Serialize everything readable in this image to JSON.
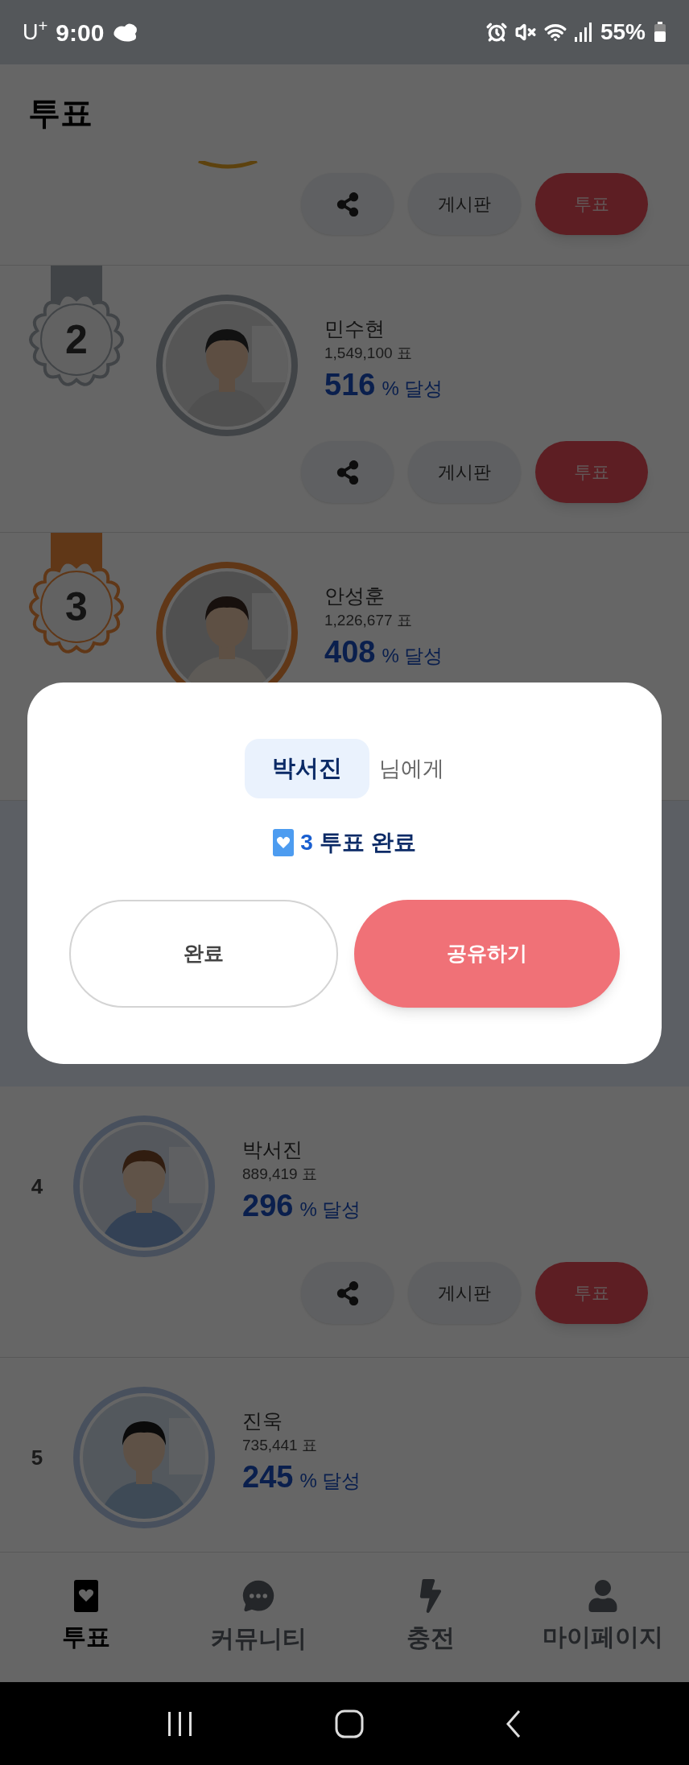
{
  "status_bar": {
    "carrier": "U$^{+}$",
    "time": "9:00",
    "battery": "55%"
  },
  "header": {
    "title": "투표"
  },
  "top_row": {
    "actions": {
      "board": "게시판",
      "vote": "투표"
    }
  },
  "ranking": [
    {
      "kind": "medal",
      "rank": "2",
      "name": "민수현",
      "votes": "1,549,100 표",
      "percent": "516",
      "percent_unit": "% 달성",
      "actions": {
        "board": "게시판",
        "vote": "투표"
      }
    },
    {
      "kind": "medal",
      "rank": "3",
      "name": "안성훈",
      "votes": "1,226,677 표",
      "percent": "408",
      "percent_unit": "% 달성"
    },
    {
      "kind": "plain",
      "rank": "4",
      "name": "박서진",
      "votes": "889,419 표",
      "percent": "296",
      "percent_unit": "% 달성",
      "actions": {
        "board": "게시판",
        "vote": "투표"
      }
    },
    {
      "kind": "plain",
      "rank": "5",
      "name": "진욱",
      "votes": "735,441 표",
      "percent": "245",
      "percent_unit": "% 달성"
    }
  ],
  "modal": {
    "name": "박서진",
    "suffix": "님에게",
    "count": "3",
    "message": "투표 완료",
    "buttons": [
      {
        "kind": "secondary",
        "label": "완료"
      },
      {
        "kind": "primary",
        "label": "공유하기"
      }
    ]
  },
  "bottom_nav": [
    {
      "label": "투표",
      "selected": true
    },
    {
      "label": "커뮤니티",
      "selected": false
    },
    {
      "label": "충전",
      "selected": false
    },
    {
      "label": "마이페이지",
      "selected": false
    }
  ]
}
